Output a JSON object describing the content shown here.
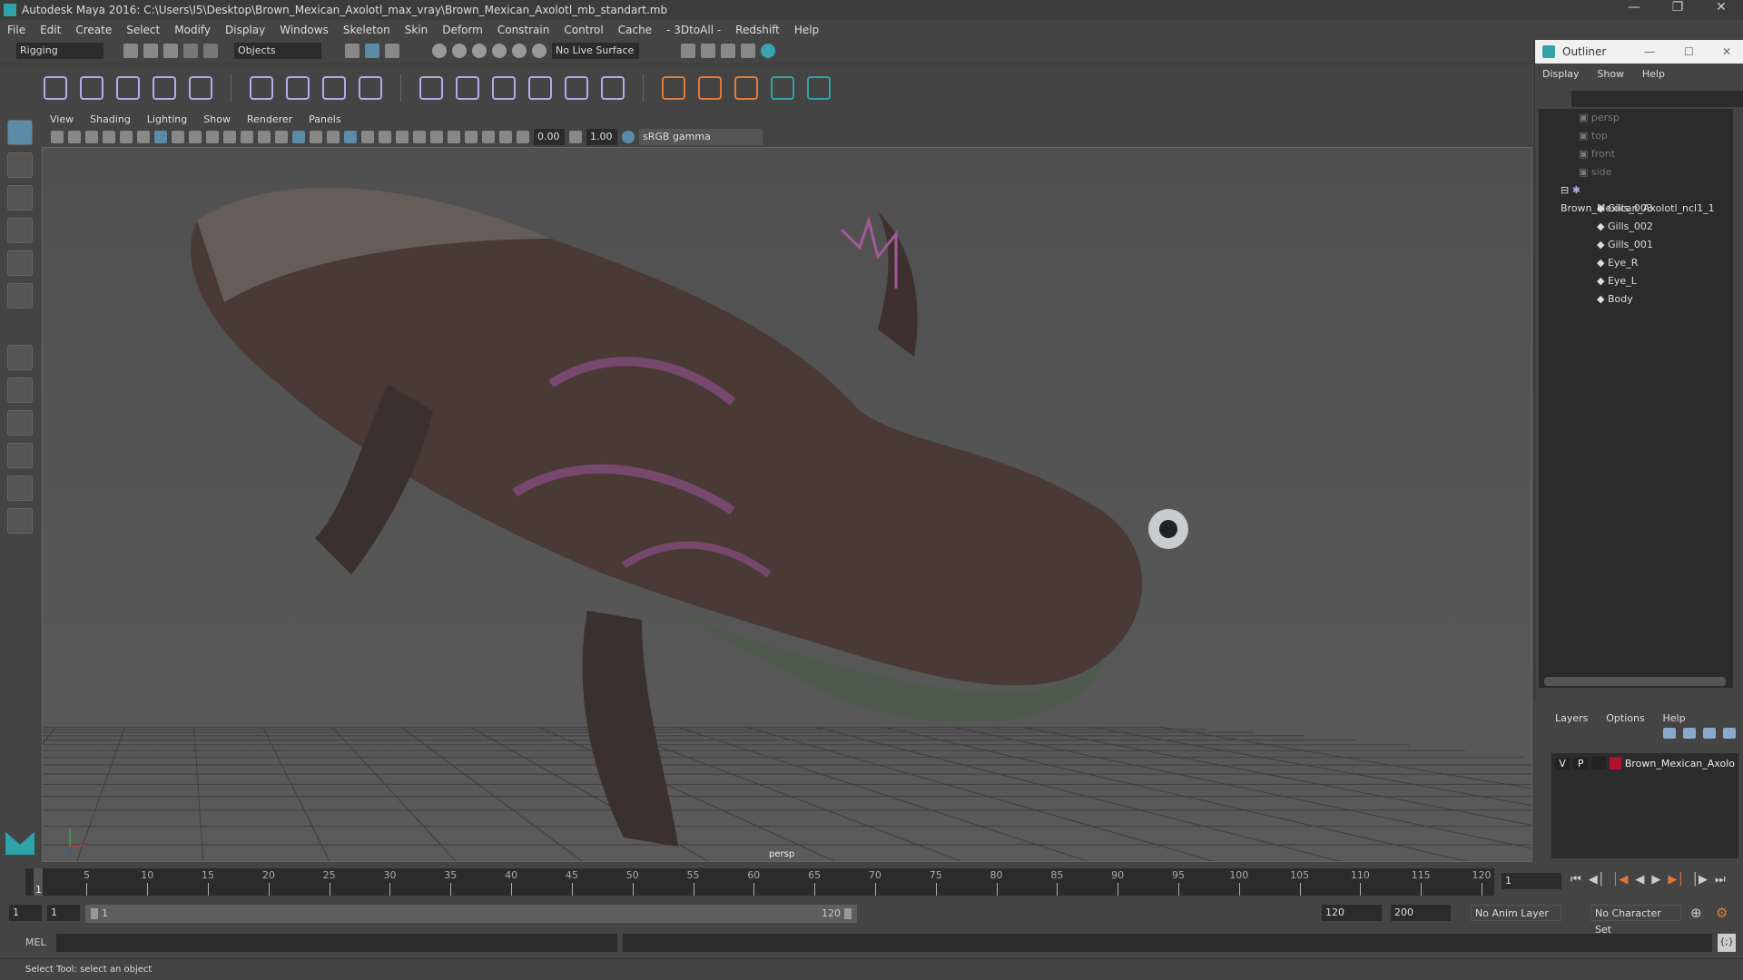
{
  "title": "Autodesk Maya 2016: C:\\Users\\I5\\Desktop\\Brown_Mexican_Axolotl_max_vray\\Brown_Mexican_Axolotl_mb_standart.mb",
  "menu": [
    "File",
    "Edit",
    "Create",
    "Select",
    "Modify",
    "Display",
    "Windows",
    "Skeleton",
    "Skin",
    "Deform",
    "Constrain",
    "Control",
    "Cache",
    "- 3DtoAll -",
    "Redshift",
    "Help"
  ],
  "status": {
    "menuset": "Rigging",
    "selmode": "Objects",
    "live_surface": "No Live Surface"
  },
  "panel_menu": [
    "View",
    "Shading",
    "Lighting",
    "Show",
    "Renderer",
    "Panels"
  ],
  "panel_toolbar": {
    "exposure": "0.00",
    "gamma": "1.00",
    "colorspace": "sRGB gamma"
  },
  "viewport": {
    "camera_label": "persp"
  },
  "outliner": {
    "title": "Outliner",
    "menu": [
      "Display",
      "Show",
      "Help"
    ],
    "cameras": [
      "persp",
      "top",
      "front",
      "side"
    ],
    "group": "Brown_Mexican_Axolotl_ncl1_1",
    "children": [
      "Gills_003",
      "Gills_002",
      "Gills_001",
      "Eye_R",
      "Eye_L",
      "Body"
    ]
  },
  "layers": {
    "menu": [
      "Layers",
      "Options",
      "Help"
    ],
    "layer": {
      "v": "V",
      "p": "P",
      "name": "Brown_Mexican_Axolo",
      "color": "#b0102a"
    }
  },
  "timeline": {
    "ticks": [
      5,
      10,
      15,
      20,
      25,
      30,
      35,
      40,
      45,
      50,
      55,
      60,
      65,
      70,
      75,
      80,
      85,
      90,
      95,
      100,
      105,
      110,
      115,
      120
    ],
    "start": 1,
    "end": 120,
    "current_marker": "1",
    "current_frame": "1"
  },
  "range": {
    "start": "1",
    "playback_start": "1",
    "slider_start": "1",
    "slider_end": "120",
    "playback_end": "120",
    "end": "200",
    "anim_layer": "No Anim Layer",
    "char_set": "No Character Set"
  },
  "cmd": {
    "label": "MEL"
  },
  "help_line": "Select Tool: select an object",
  "accent": "#5b8ba8"
}
